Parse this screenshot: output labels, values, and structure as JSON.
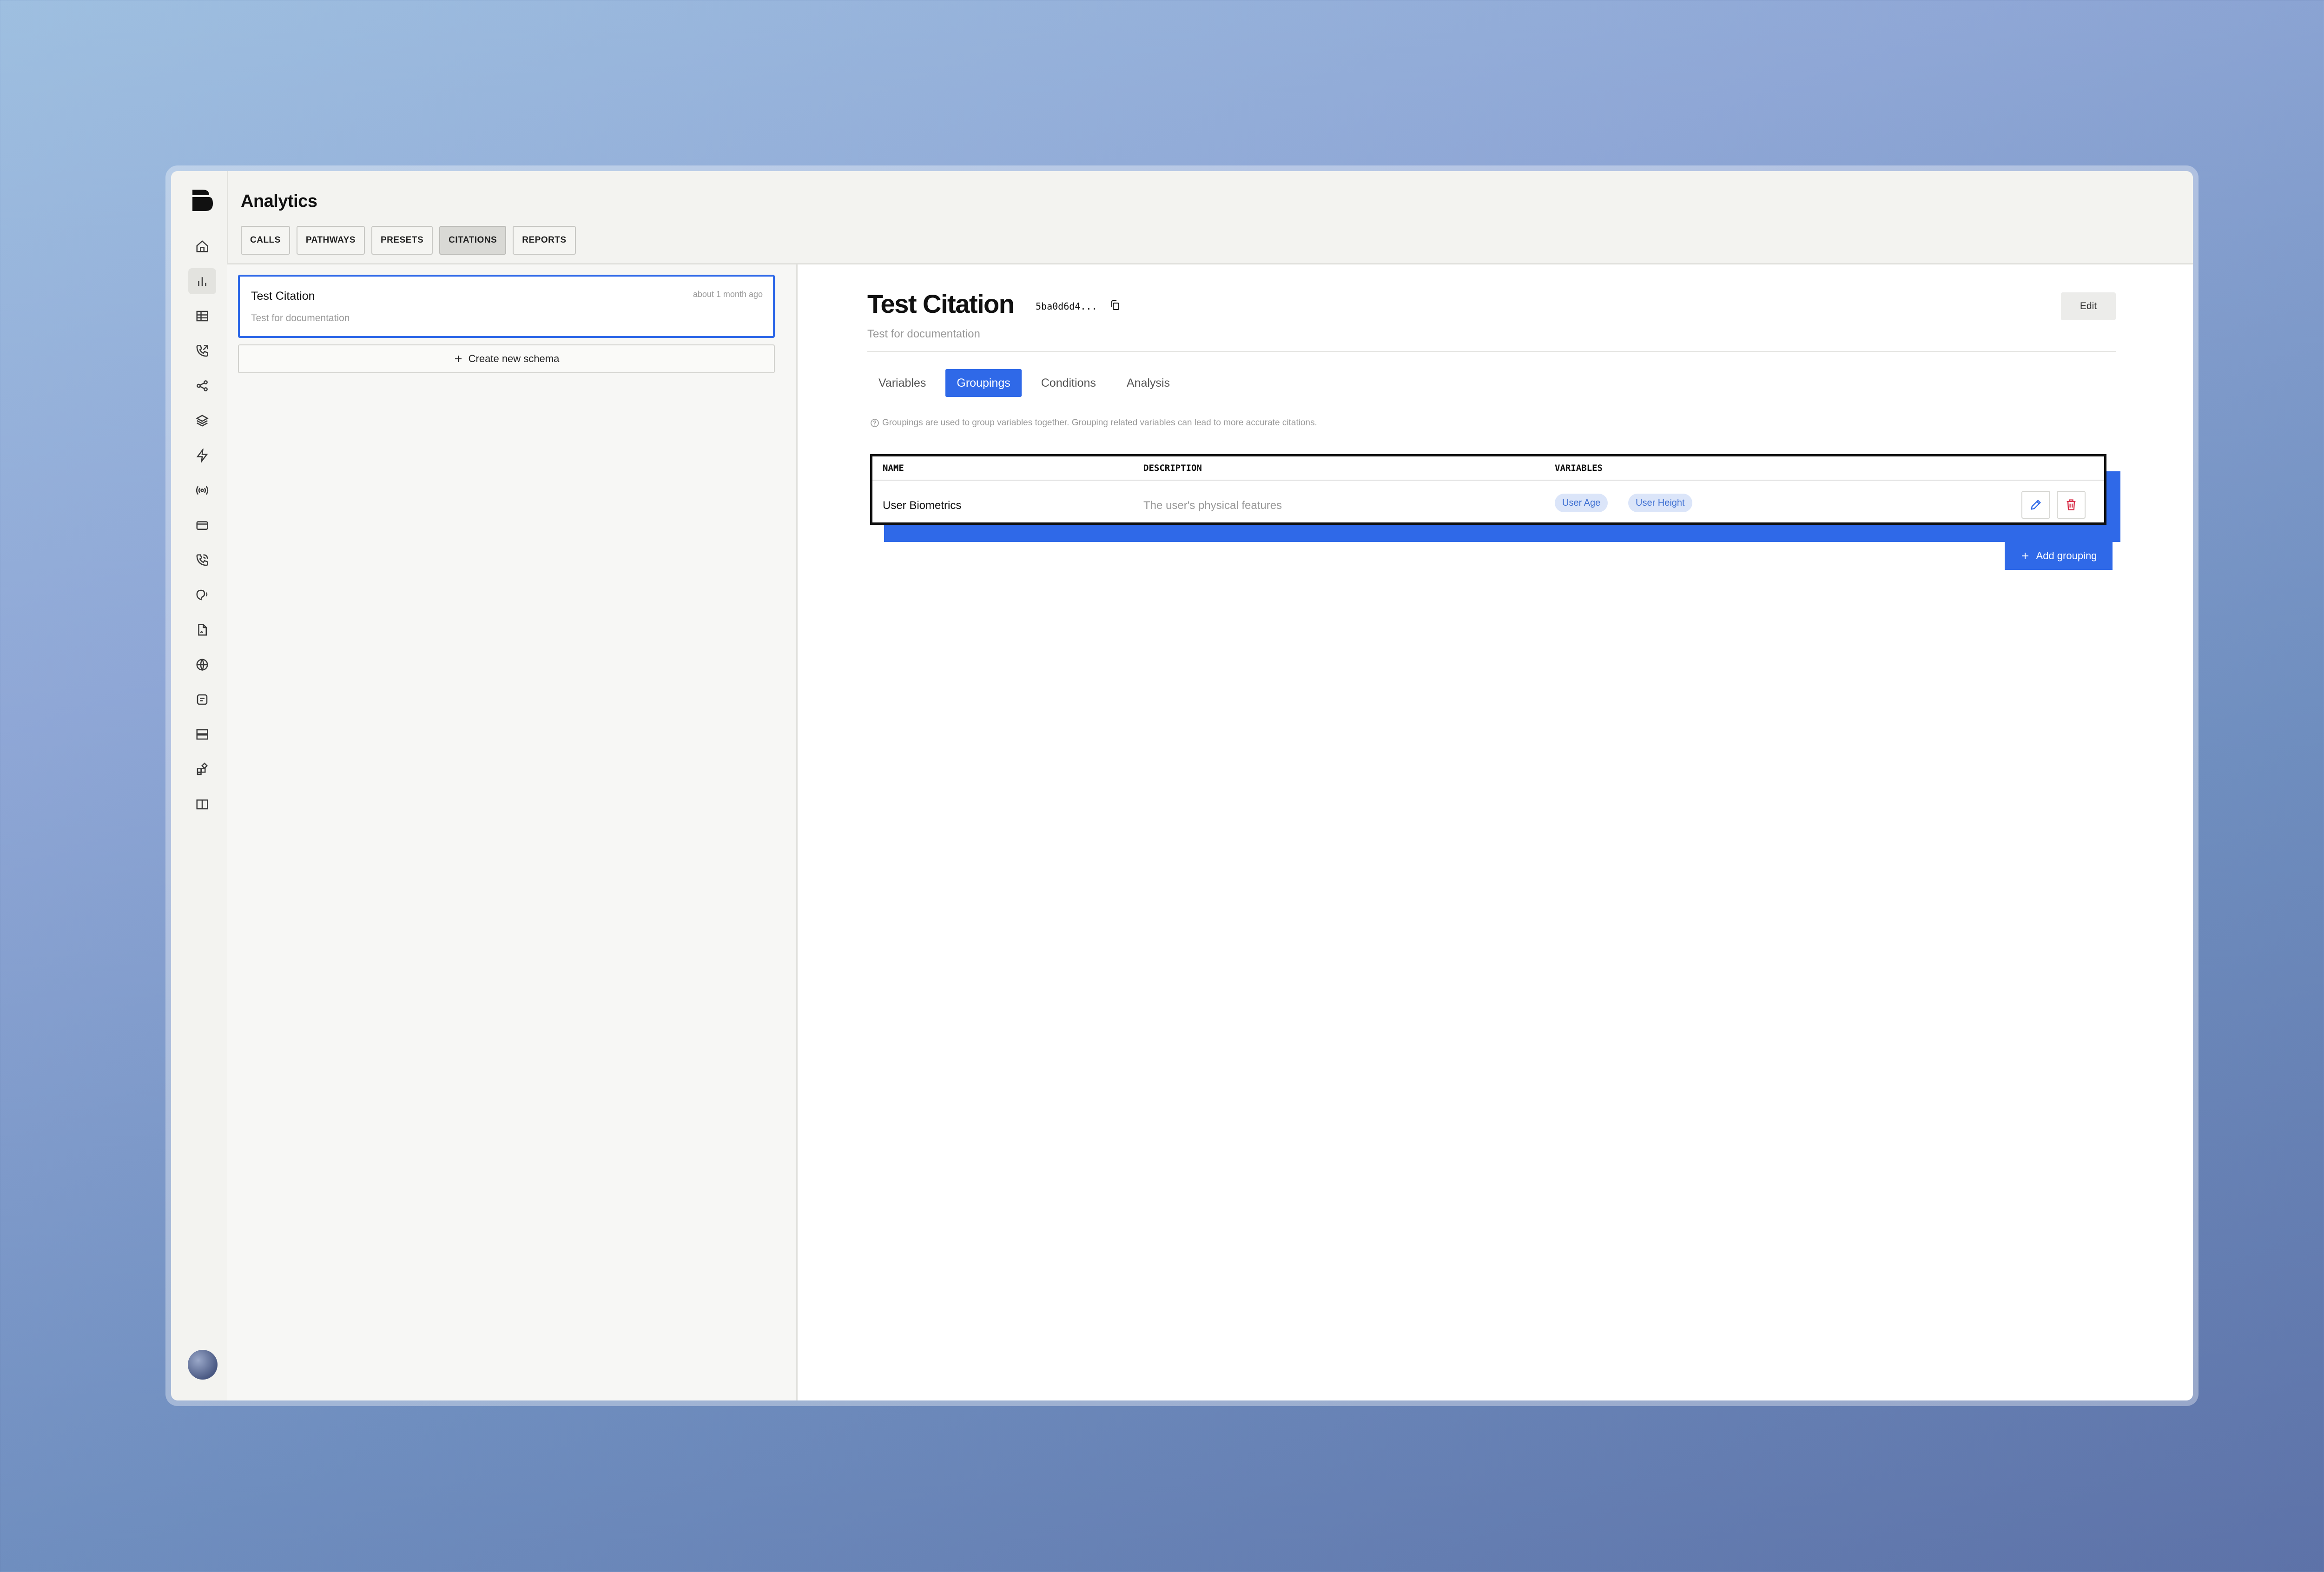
{
  "app": {
    "title": "Analytics"
  },
  "nav_tabs": [
    {
      "label": "CALLS"
    },
    {
      "label": "PATHWAYS"
    },
    {
      "label": "PRESETS"
    },
    {
      "label": "CITATIONS"
    },
    {
      "label": "REPORTS"
    }
  ],
  "active_nav_tab": "CITATIONS",
  "sidebar_icons": [
    "home-icon",
    "chart-icon",
    "table-icon",
    "phone-outgoing-icon",
    "share-icon",
    "layers-icon",
    "bolt-icon",
    "broadcast-icon",
    "card-icon",
    "phone-call-icon",
    "voice-icon",
    "file-icon",
    "globe-icon",
    "message-icon",
    "server-icon",
    "widgets-icon",
    "book-icon"
  ],
  "citations": [
    {
      "title": "Test Citation",
      "time": "about 1 month ago",
      "description": "Test for documentation"
    }
  ],
  "create_button": {
    "label": "Create new schema"
  },
  "detail": {
    "title": "Test Citation",
    "id": "5ba0d6d4...",
    "description": "Test for documentation",
    "edit_label": "Edit",
    "tabs": [
      {
        "label": "Variables"
      },
      {
        "label": "Groupings"
      },
      {
        "label": "Conditions"
      },
      {
        "label": "Analysis"
      }
    ],
    "active_tab": "Groupings",
    "info": "Groupings are used to group variables together. Grouping related variables can lead to more accurate citations.",
    "table": {
      "headers": {
        "name": "NAME",
        "description": "DESCRIPTION",
        "variables": "VARIABLES"
      },
      "rows": [
        {
          "name": "User Biometrics",
          "description": "The user's physical features",
          "variables": [
            "User Age",
            "User Height"
          ]
        }
      ]
    },
    "add_label": "Add grouping"
  },
  "colors": {
    "accent": "#2f69e8",
    "danger": "#d9304a",
    "pill_bg": "#dbe5f9"
  }
}
